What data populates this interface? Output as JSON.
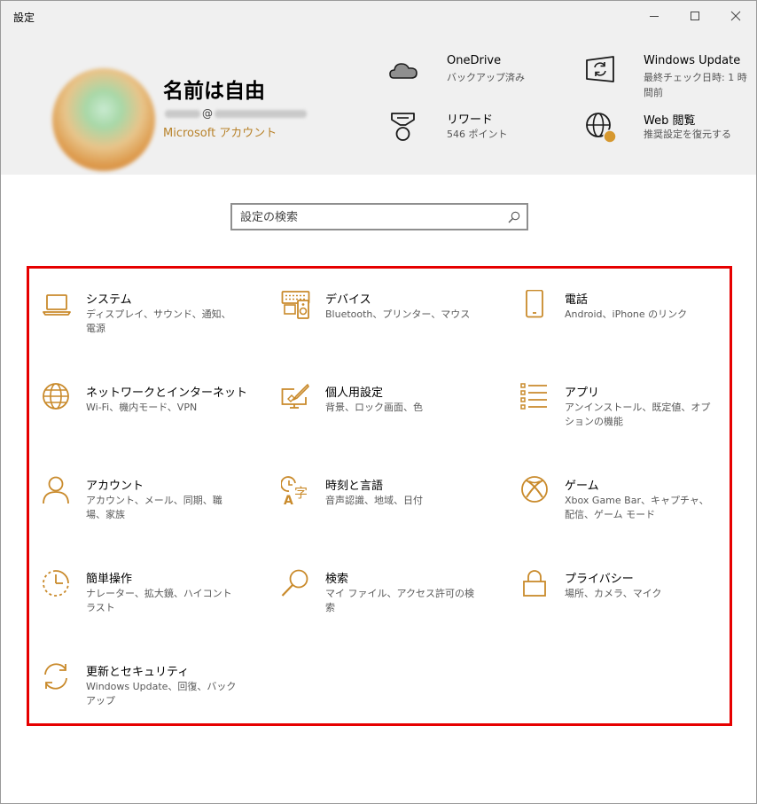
{
  "window": {
    "title": "設定"
  },
  "account": {
    "name": "名前は自由",
    "email_at": "@",
    "microsoft_account": "Microsoft アカウント"
  },
  "header_items": {
    "onedrive": {
      "title": "OneDrive",
      "sub": "バックアップ済み"
    },
    "rewards": {
      "title": "リワード",
      "sub": "546 ポイント"
    },
    "windows_update": {
      "title": "Windows Update",
      "sub": "最終チェック日時: 1 時間前"
    },
    "web_browsing": {
      "title": "Web 閲覧",
      "sub": "推奨設定を復元する"
    }
  },
  "search": {
    "placeholder": "設定の検索"
  },
  "categories": [
    {
      "name": "システム",
      "desc": "ディスプレイ、サウンド、通知、電源",
      "icon": "laptop-icon"
    },
    {
      "name": "デバイス",
      "desc": "Bluetooth、プリンター、マウス",
      "icon": "keyboard-speaker-icon"
    },
    {
      "name": "電話",
      "desc": "Android、iPhone のリンク",
      "icon": "phone-icon"
    },
    {
      "name": "ネットワークとインターネット",
      "desc": "Wi-Fi、機内モード、VPN",
      "icon": "globe-icon"
    },
    {
      "name": "個人用設定",
      "desc": "背景、ロック画面、色",
      "icon": "paintbrush-display-icon"
    },
    {
      "name": "アプリ",
      "desc": "アンインストール、既定値、オプションの機能",
      "icon": "apps-list-icon"
    },
    {
      "name": "アカウント",
      "desc": "アカウント、メール、同期、職場、家族",
      "icon": "person-icon"
    },
    {
      "name": "時刻と言語",
      "desc": "音声認識、地域、日付",
      "icon": "time-language-icon"
    },
    {
      "name": "ゲーム",
      "desc": "Xbox Game Bar、キャプチャ、配信、ゲーム モード",
      "icon": "xbox-icon"
    },
    {
      "name": "簡単操作",
      "desc": "ナレーター、拡大鏡、ハイコントラスト",
      "icon": "ease-of-access-icon"
    },
    {
      "name": "検索",
      "desc": "マイ ファイル、アクセス許可の検索",
      "icon": "magnifier-icon"
    },
    {
      "name": "プライバシー",
      "desc": "場所、カメラ、マイク",
      "icon": "lock-icon"
    },
    {
      "name": "更新とセキュリティ",
      "desc": "Windows Update、回復、バックアップ",
      "icon": "sync-icon"
    }
  ],
  "colors": {
    "accent": "#c98a2b",
    "highlight_border": "#e60000",
    "header_bg": "#f0f0f0"
  }
}
